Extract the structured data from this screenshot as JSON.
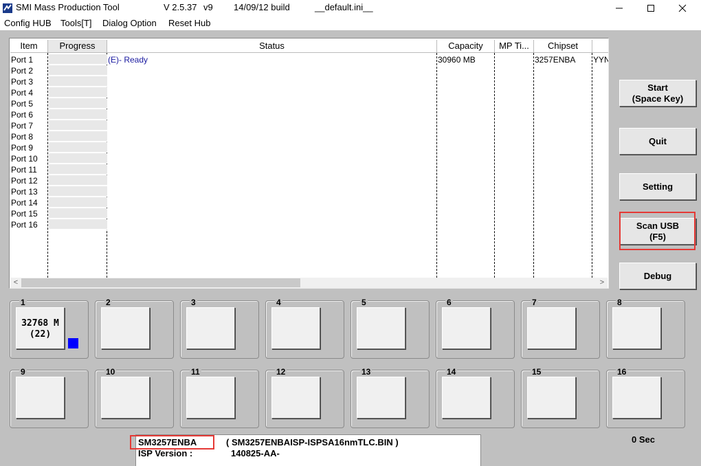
{
  "title_bar": {
    "app_name": "SMI Mass Production Tool",
    "version": "V 2.5.37",
    "variant": "v9",
    "build": "14/09/12 build",
    "ini_file": "__default.ini__",
    "minimize": "–",
    "maximize": "☐",
    "close": "✕"
  },
  "menu": [
    "Config HUB",
    "Tools[T]",
    "Dialog Option",
    "Reset Hub"
  ],
  "list": {
    "columns": [
      "Item",
      "Progress",
      "Status",
      "Capacity",
      "MP Ti...",
      "Chipset"
    ],
    "rows": [
      {
        "item": "Port 1",
        "status": "(E)- Ready",
        "capacity": "30960 MB",
        "chipset": "3257ENBA",
        "extra": "YYN"
      },
      {
        "item": "Port 2"
      },
      {
        "item": "Port 3"
      },
      {
        "item": "Port 4"
      },
      {
        "item": "Port 5"
      },
      {
        "item": "Port 6"
      },
      {
        "item": "Port 7"
      },
      {
        "item": "Port 8"
      },
      {
        "item": "Port 9"
      },
      {
        "item": "Port 10"
      },
      {
        "item": "Port 11"
      },
      {
        "item": "Port 12"
      },
      {
        "item": "Port 13"
      },
      {
        "item": "Port 14"
      },
      {
        "item": "Port 15"
      },
      {
        "item": "Port 16"
      }
    ],
    "scroll_left": "<",
    "scroll_right": ">"
  },
  "buttons": {
    "start_line1": "Start",
    "start_line2": "(Space Key)",
    "quit": "Quit",
    "setting": "Setting",
    "scan_line1": "Scan USB",
    "scan_line2": "(F5)",
    "debug": "Debug"
  },
  "ports": [
    {
      "number": "1",
      "line1": "32768 M",
      "line2": "(22)",
      "indicator_color": "#0000ff"
    },
    {
      "number": "2"
    },
    {
      "number": "3"
    },
    {
      "number": "4"
    },
    {
      "number": "5"
    },
    {
      "number": "6"
    },
    {
      "number": "7"
    },
    {
      "number": "8"
    },
    {
      "number": "9"
    },
    {
      "number": "10"
    },
    {
      "number": "11"
    },
    {
      "number": "12"
    },
    {
      "number": "13"
    },
    {
      "number": "14"
    },
    {
      "number": "15"
    },
    {
      "number": "16"
    }
  ],
  "info": {
    "chip_model": "SM3257ENBA",
    "isp_file": "( SM3257ENBAISP-ISPSA16nmTLC.BIN )",
    "isp_label": "ISP Version :",
    "isp_version": "140825-AA-"
  },
  "elapsed": "0 Sec",
  "colors": {
    "highlight": "#e53935",
    "status_text": "#1a1aa0",
    "indicator": "#0000ff"
  }
}
